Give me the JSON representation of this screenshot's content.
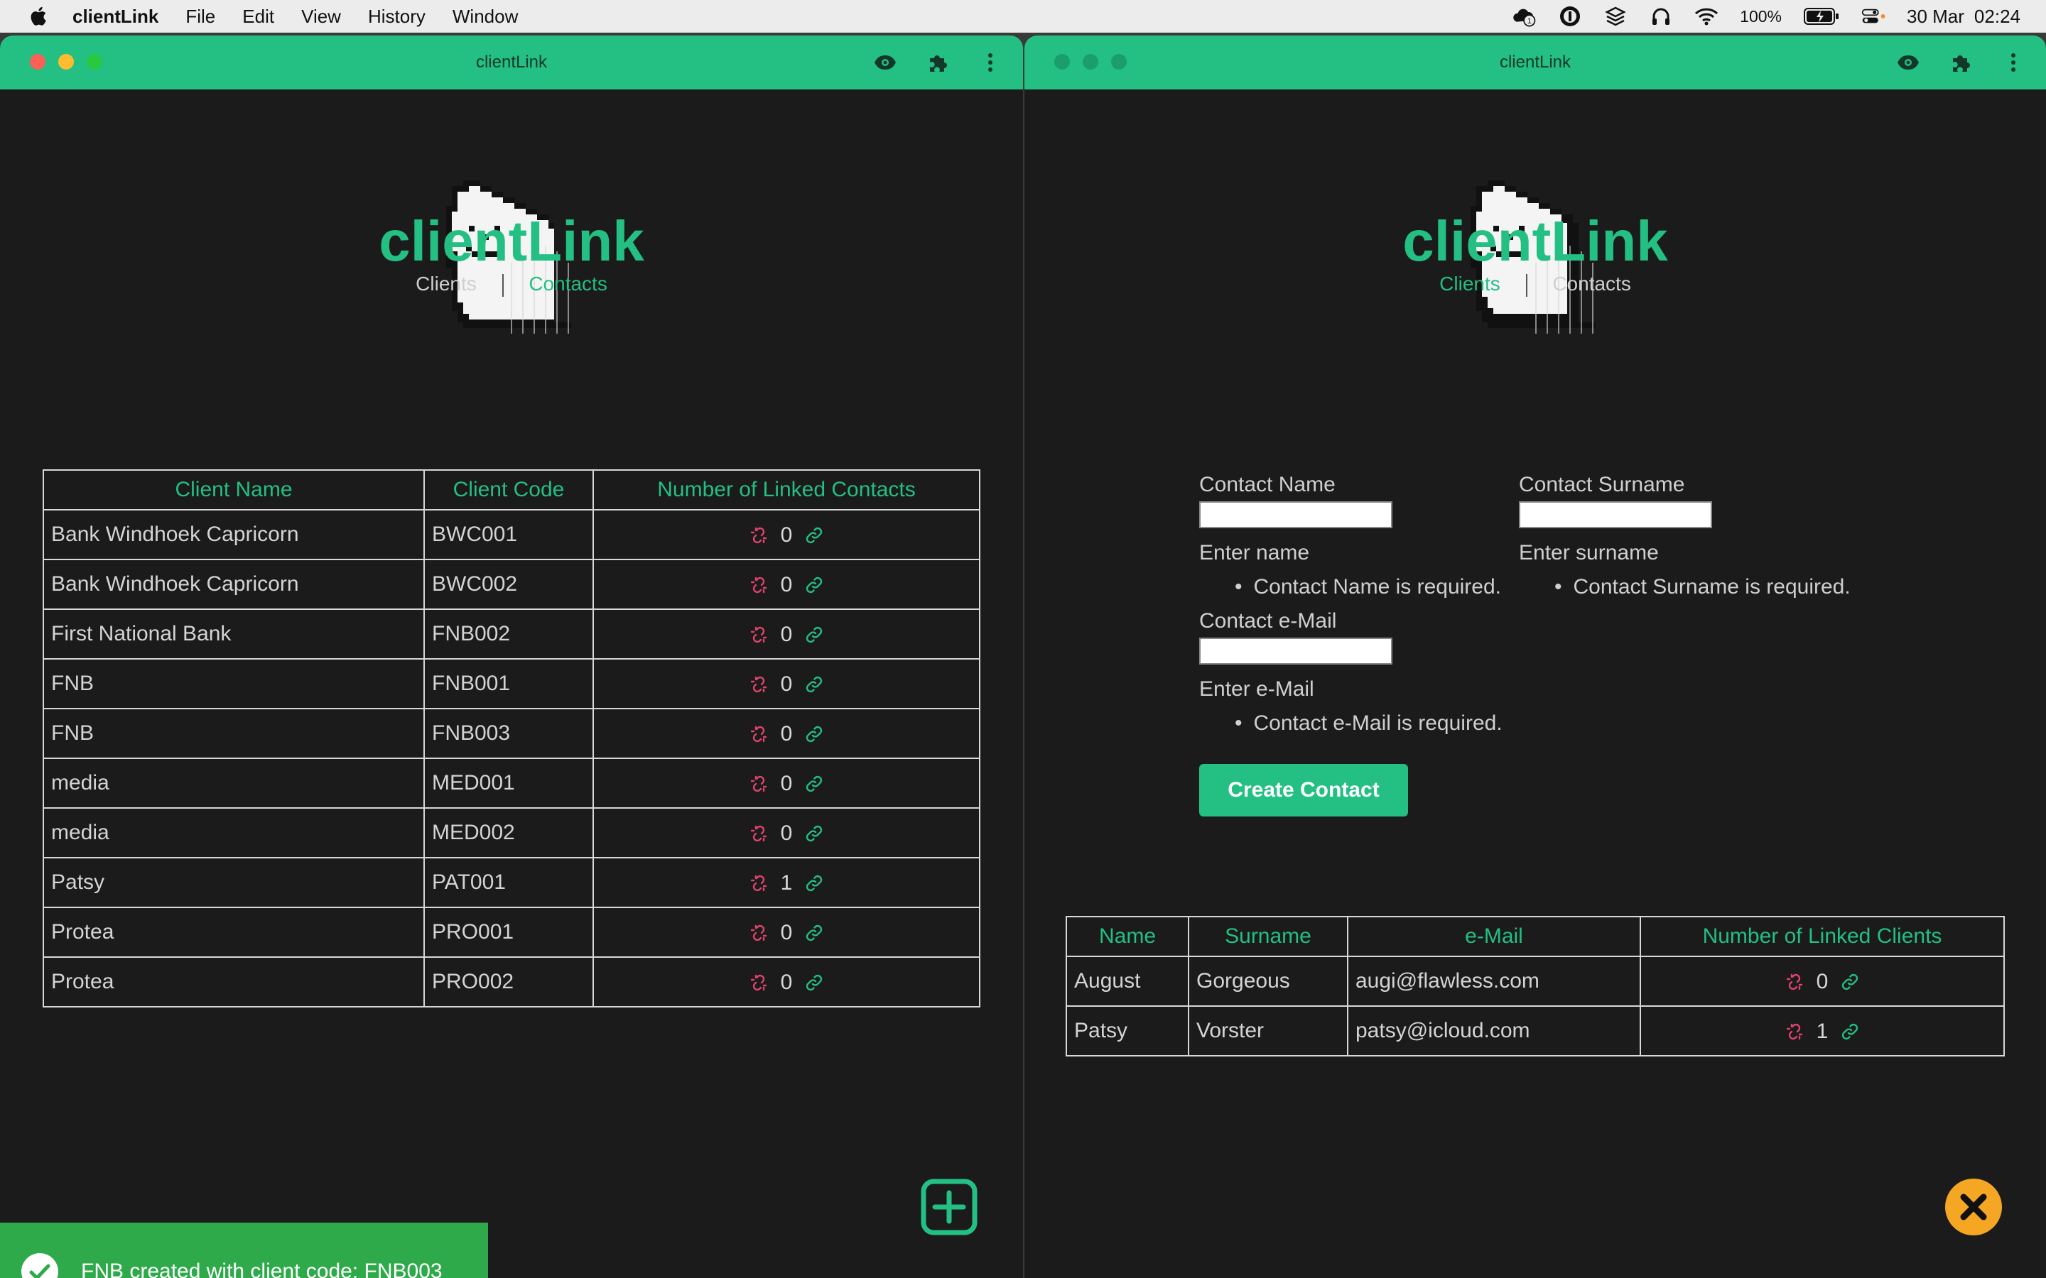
{
  "menubar": {
    "app_name": "clientLink",
    "menus": [
      "File",
      "Edit",
      "View",
      "History",
      "Window"
    ],
    "battery": "100%",
    "date": "30 Mar",
    "time": "02:24",
    "notification_count": "1"
  },
  "left_window": {
    "title": "clientLink",
    "app_title": "clientLink",
    "nav": {
      "clients": "Clients",
      "contacts": "Contacts",
      "active": "clients"
    },
    "table": {
      "headers": [
        "Client Name",
        "Client Code",
        "Number of Linked Contacts"
      ],
      "rows": [
        {
          "name": "Bank Windhoek Capricorn",
          "code": "BWC001",
          "linked": "0"
        },
        {
          "name": "Bank Windhoek Capricorn",
          "code": "BWC002",
          "linked": "0"
        },
        {
          "name": "First National Bank",
          "code": "FNB002",
          "linked": "0"
        },
        {
          "name": "FNB",
          "code": "FNB001",
          "linked": "0"
        },
        {
          "name": "FNB",
          "code": "FNB003",
          "linked": "0"
        },
        {
          "name": "media",
          "code": "MED001",
          "linked": "0"
        },
        {
          "name": "media",
          "code": "MED002",
          "linked": "0"
        },
        {
          "name": "Patsy",
          "code": "PAT001",
          "linked": "1"
        },
        {
          "name": "Protea",
          "code": "PRO001",
          "linked": "0"
        },
        {
          "name": "Protea",
          "code": "PRO002",
          "linked": "0"
        }
      ]
    },
    "toast": {
      "message": "FNB created with client code: FNB003"
    }
  },
  "right_window": {
    "title": "clientLink",
    "app_title": "clientLink",
    "nav": {
      "clients": "Clients",
      "contacts": "Contacts",
      "active": "contacts"
    },
    "form": {
      "name_label": "Contact Name",
      "name_value": "",
      "name_hint": "Enter name",
      "name_error": "Contact Name is required.",
      "surname_label": "Contact Surname",
      "surname_value": "",
      "surname_hint": "Enter surname",
      "surname_error": "Contact Surname is required.",
      "email_label": "Contact e-Mail",
      "email_value": "",
      "email_hint": "Enter e-Mail",
      "email_error": "Contact e-Mail is required.",
      "submit_label": "Create Contact"
    },
    "table": {
      "headers": [
        "Name",
        "Surname",
        "e-Mail",
        "Number of Linked Clients"
      ],
      "rows": [
        {
          "name": "August",
          "surname": "Gorgeous",
          "email": "augi@flawless.com",
          "linked": "0"
        },
        {
          "name": "Patsy",
          "surname": "Vorster",
          "email": "patsy@icloud.com",
          "linked": "1"
        }
      ]
    }
  },
  "colors": {
    "accent": "#23bf83",
    "background": "#1b1b1b",
    "unlink": "#e0436c",
    "toast": "#2eaa4a",
    "close_fab": "#f5a623"
  },
  "icons": {
    "eye": "eye-icon",
    "extensions": "puzzle-icon",
    "menu": "kebab-menu-icon",
    "unlink": "unlink-icon",
    "link": "link-icon",
    "add": "plus-square-icon",
    "close": "close-circle-icon",
    "toast": "check-circle-icon"
  }
}
